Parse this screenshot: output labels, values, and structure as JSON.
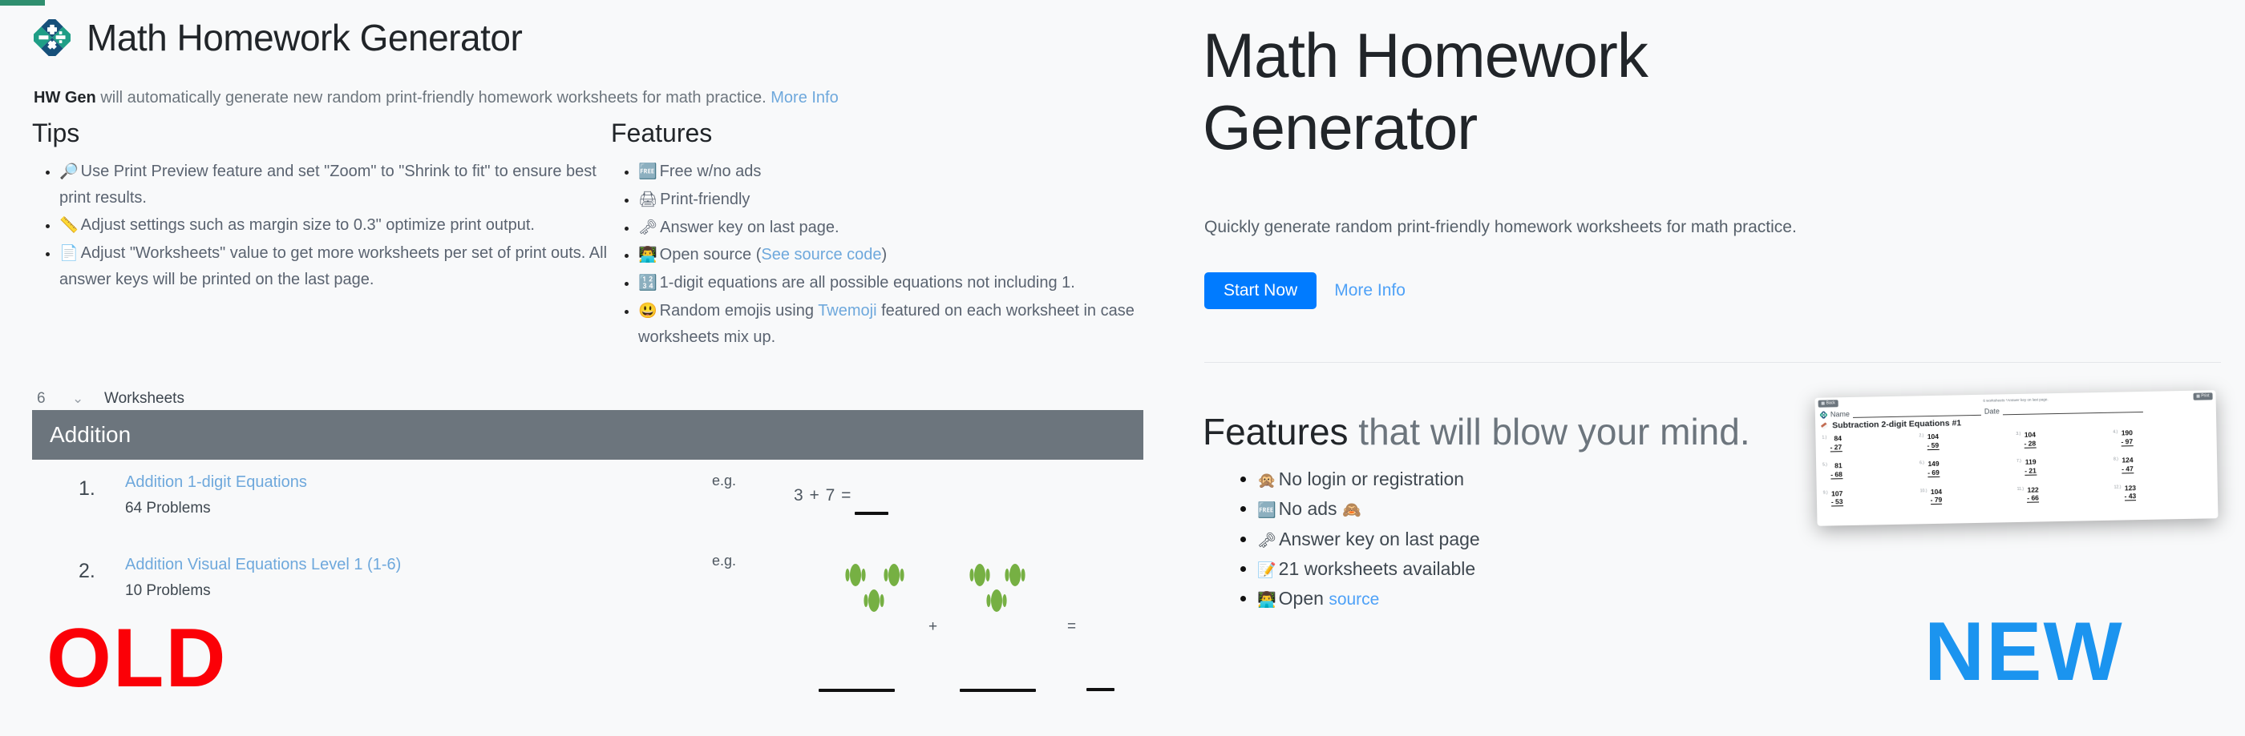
{
  "app": {
    "name": "Math Homework Generator",
    "logo_icon": "math-operations-diamond-logo"
  },
  "old": {
    "title": "Math Homework Generator",
    "lead_bold": "HW Gen",
    "lead_text": " will automatically generate new random print-friendly homework worksheets for math practice. ",
    "lead_link": "More Info",
    "tips": {
      "heading": "Tips",
      "items": [
        {
          "icon": "magnifying-glass-icon",
          "emoji": "🔎",
          "text": "Use Print Preview feature and set \"Zoom\" to \"Shrink to fit\" to ensure best print results."
        },
        {
          "icon": "ruler-icon",
          "emoji": "📏",
          "text": "Adjust settings such as margin size to 0.3\" optimize print output."
        },
        {
          "icon": "page-icon",
          "emoji": "📄",
          "text": "Adjust \"Worksheets\" value to get more worksheets per set of print outs. All answer keys will be printed on the last page."
        }
      ]
    },
    "features": {
      "heading": "Features",
      "items": [
        {
          "icon": "free-icon",
          "emoji": "🆓",
          "text": "Free w/no ads",
          "link": null,
          "tail": ""
        },
        {
          "icon": "printer-icon",
          "emoji": "🖨",
          "text": "Print-friendly",
          "link": null,
          "tail": ""
        },
        {
          "icon": "key-icon",
          "emoji": "🗝",
          "text": "Answer key on last page.",
          "link": null,
          "tail": ""
        },
        {
          "icon": "technologist-icon",
          "emoji": "👨‍💻",
          "text": "Open source (",
          "link": "See source code",
          "tail": ")"
        },
        {
          "icon": "input-numbers-icon",
          "emoji": "🔢",
          "text": "1-digit equations are all possible equations not including 1.",
          "link": null,
          "tail": ""
        },
        {
          "icon": "grinning-face-icon",
          "emoji": "😃",
          "text": "Random emojis using ",
          "link": "Twemoji",
          "tail": " featured on each worksheet in case worksheets mix up."
        }
      ]
    },
    "worksheets_selector": {
      "value": "6",
      "caret_icon": "chevron-down-icon",
      "label": "Worksheets"
    },
    "section": {
      "title": "Addition",
      "items": [
        {
          "number": "1.",
          "name": "Addition 1-digit Equations",
          "problems": "64 Problems",
          "eg_label": "e.g.",
          "eg_equation": "3 + 7 ="
        },
        {
          "number": "2.",
          "name": "Addition Visual Equations Level 1 (1-6)",
          "problems": "10 Problems",
          "eg_label": "e.g.",
          "eg_plus": "+",
          "eg_equals": "="
        }
      ]
    },
    "stamp": "OLD",
    "stamp_color": "#fb0007"
  },
  "new": {
    "title": "Math Homework Generator",
    "subtitle": "Quickly generate random print-friendly homework worksheets for math practice.",
    "cta_button": "Start Now",
    "more_info": "More Info",
    "features_heading_bold": "Features",
    "features_heading_rest": " that will blow your mind.",
    "features": [
      {
        "icon": "speak-no-evil-monkey-icon",
        "emoji": "🙊",
        "text": "No login or registration",
        "link": null,
        "tail": ""
      },
      {
        "icon": "free-icon",
        "emoji": "🆓",
        "text": "No ads ",
        "emoji2": "🙈",
        "icon2": "see-no-evil-monkey-icon",
        "link": null,
        "tail": ""
      },
      {
        "icon": "key-icon",
        "emoji": "🗝",
        "text": "Answer key on last page",
        "link": null,
        "tail": ""
      },
      {
        "icon": "memo-icon",
        "emoji": "📝",
        "text": "21 worksheets available",
        "link": null,
        "tail": ""
      },
      {
        "icon": "technologist-icon",
        "emoji": "👨‍💻",
        "text": "Open ",
        "link": "source",
        "tail": ""
      }
    ],
    "stamp": "NEW",
    "stamp_color": "#1b94ef",
    "accent_color": "#007bff",
    "link_color": "#4ea1f7"
  },
  "thumbnail": {
    "back_button": "Back",
    "print_button": "Print",
    "note": "6 worksheets *Answer key on last page.",
    "name_label": "Name",
    "date_label": "Date",
    "worksheet_title": "Subtraction 2-digit Equations #1",
    "problems": [
      {
        "n": "1.)",
        "top": "84",
        "bottom": "- 27"
      },
      {
        "n": "2.)",
        "top": "104",
        "bottom": "- 59"
      },
      {
        "n": "3.)",
        "top": "104",
        "bottom": "- 28"
      },
      {
        "n": "4.)",
        "top": "190",
        "bottom": "- 97"
      },
      {
        "n": "5.)",
        "top": "81",
        "bottom": "- 68"
      },
      {
        "n": "6.)",
        "top": "149",
        "bottom": "- 69"
      },
      {
        "n": "7.)",
        "top": "119",
        "bottom": "- 21"
      },
      {
        "n": "8.)",
        "top": "124",
        "bottom": "- 47"
      },
      {
        "n": "9.)",
        "top": "107",
        "bottom": "- 53"
      },
      {
        "n": "10.)",
        "top": "104",
        "bottom": "- 79"
      },
      {
        "n": "11.)",
        "top": "122",
        "bottom": "- 66"
      },
      {
        "n": "12.)",
        "top": "123",
        "bottom": "- 43"
      }
    ]
  }
}
